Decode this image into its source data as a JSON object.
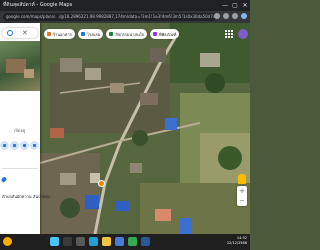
{
  "window": {
    "title": "ที่ดินสุดสัปดาห์ - Google Maps",
    "controls": [
      "—",
      "▢",
      "✕"
    ]
  },
  "address_bar": {
    "url": "google.com/maps/place/.../@18.2896221,98.9982887,174m/data=!3m1!1e3!4m6!3m5!1s0x30da50d7d5d18b53:0x3f1b2e6f0d5e4a1c!8m2!3d18.2896!4d98.998!16s",
    "icons": [
      "share-icon",
      "star-icon",
      "extensions-icon",
      "profile-icon"
    ]
  },
  "panel": {
    "search_clear": "✕",
    "status": "เปิดอยู่",
    "actions": [
      {
        "name": "directions",
        "label": ""
      },
      {
        "name": "save",
        "label": ""
      },
      {
        "name": "nearby",
        "label": ""
      },
      {
        "name": "share",
        "label": ""
      }
    ],
    "address": "ตำบลสันผักหวาน สันป่าตอง"
  },
  "chips": [
    {
      "label": "ร้านอาหาร",
      "color": "#e8710a"
    },
    {
      "label": "โรงแรม",
      "color": "#1a73e8"
    },
    {
      "label": "กิจกรรมน่าสนใจ",
      "color": "#188038"
    },
    {
      "label": "พิพิธภัณฑ์",
      "color": "#9334e6"
    },
    {
      "label": "ขนส่งสาธารณะ",
      "color": "#1a73e8"
    },
    {
      "label": "ร้านขายยา",
      "color": "#d93025"
    }
  ],
  "zoom": {
    "in": "+",
    "out": "−"
  },
  "taskbar": {
    "time": "14:32",
    "date": "12/12/2566",
    "lang": "ENG",
    "apps": [
      "start",
      "search",
      "task-view",
      "edge",
      "explorer",
      "store",
      "chrome",
      "word"
    ]
  }
}
